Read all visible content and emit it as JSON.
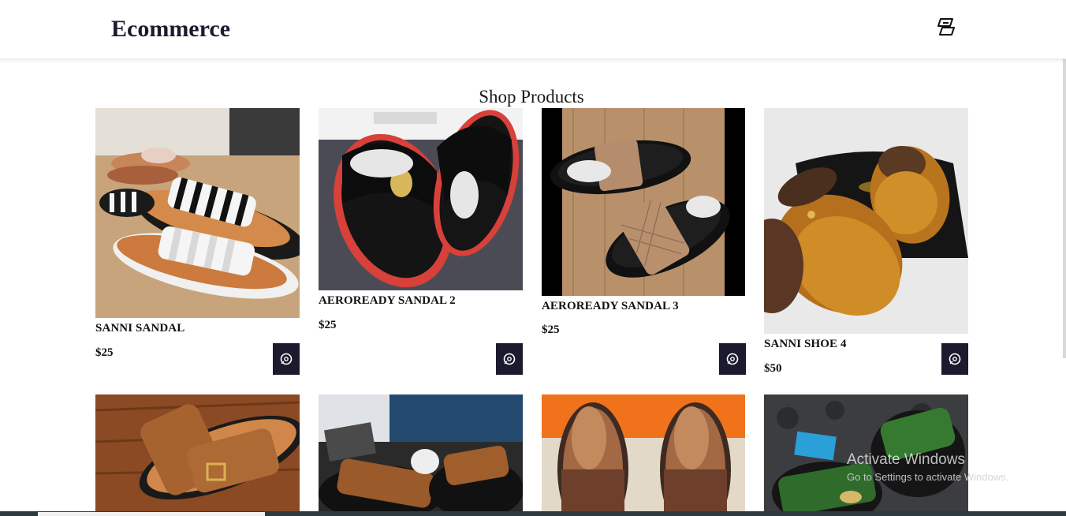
{
  "navbar": {
    "brand": "Ecommerce",
    "cart_icon": "cart-icon"
  },
  "page": {
    "title": "Shop Products"
  },
  "products": [
    {
      "name": "SANNI SANDAL",
      "price": "$25",
      "image": "white-black-striped-slides"
    },
    {
      "name": "AEROREADY SANDAL 2",
      "price": "$25",
      "image": "black-velvet-red-sole-slides"
    },
    {
      "name": "AEROREADY SANDAL 3",
      "price": "$25",
      "image": "quilted-tan-strap-slides"
    },
    {
      "name": "SANNI SHOE 4",
      "price": "$50",
      "image": "tan-leather-mule"
    },
    {
      "name": "",
      "price": "",
      "image": "brown-suede-buckle-slide"
    },
    {
      "name": "",
      "price": "",
      "image": "brown-suede-velcro-slide"
    },
    {
      "name": "",
      "price": "",
      "image": "brown-leather-slippers"
    },
    {
      "name": "",
      "price": "",
      "image": "green-strap-slides"
    }
  ],
  "add_to_cart_icon": "eye-circle-icon",
  "watermark": {
    "title": "Activate Windows",
    "subtitle": "Go to Settings to activate Windows."
  },
  "colors": {
    "brand_dark": "#1c1a2e",
    "background": "#ffffff"
  }
}
